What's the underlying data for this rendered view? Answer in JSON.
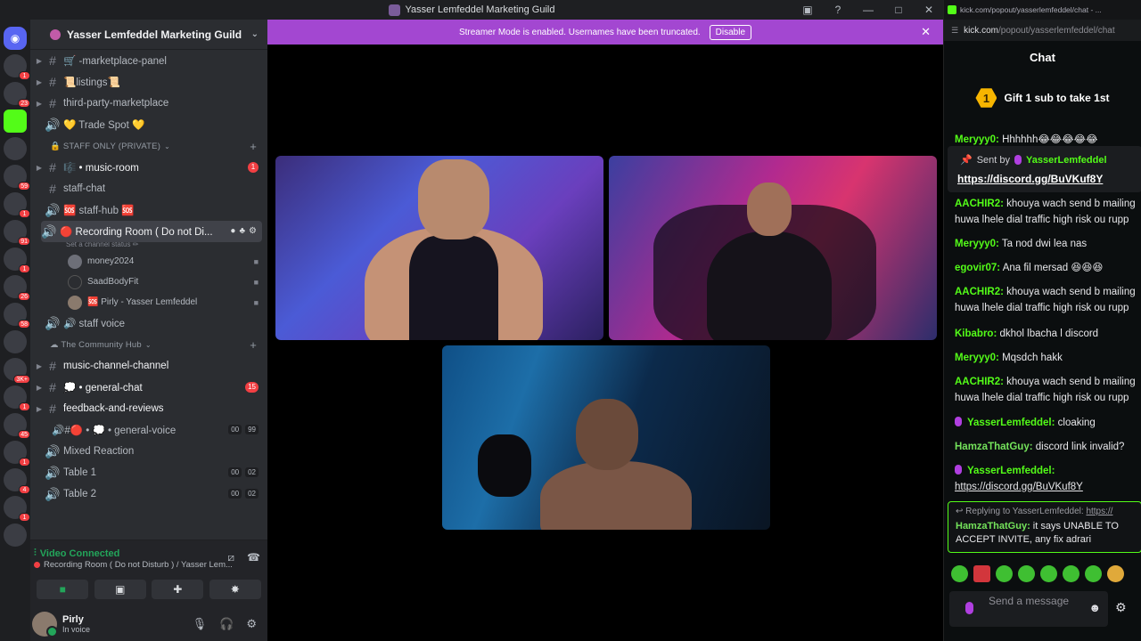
{
  "titlebar": {
    "title": "Yasser Lemfeddel Marketing Guild"
  },
  "rail_badges": [
    "1",
    "23",
    "59",
    "1",
    "91",
    "1",
    "26",
    "58",
    "3K+",
    "1",
    "45",
    "1",
    "4",
    "1"
  ],
  "guild": {
    "name": "Yasser Lemfeddel Marketing Guild"
  },
  "channels": {
    "marketplace_panel": "🛒 -marketplace-panel",
    "listings": "📜listings📜",
    "third_party": "third-party-marketplace",
    "trade_spot": "💛 Trade Spot 💛",
    "staff_category": "🔒 STAFF ONLY (PRIVATE)",
    "music_room": "🎼 • music-room",
    "music_room_badge": "1",
    "staff_chat": "staff-chat",
    "staff_hub": "🆘 staff-hub 🆘",
    "recording_room": "🔴 Recording Room ( Do not Di...",
    "set_status": "Set a channel status ✏",
    "voice_users": [
      "money2024",
      "SaadBodyFit",
      "🆘 Pirly - Yasser Lemfeddel"
    ],
    "staff_voice": "🔊 staff voice",
    "community_category": "☁ The Community Hub",
    "music_channel": "music-channel-channel",
    "general_chat": "💭 • general-chat",
    "general_chat_badge": "15",
    "feedback": "feedback-and-reviews",
    "general_voice": "🔊#🔴 • 💭 • general-voice",
    "general_voice_a": "00",
    "general_voice_b": "99",
    "mixed_reaction": "Mixed Reaction",
    "table1": "Table 1",
    "table1_a": "00",
    "table1_b": "02",
    "table2": "Table 2",
    "table2_a": "00",
    "table2_b": "02"
  },
  "voice": {
    "status": "Video Connected",
    "channel": "Recording Room ( Do not Disturb ) / Yasser Lem..."
  },
  "user": {
    "name": "Pirly",
    "status": "In voice"
  },
  "banner": {
    "text": "Streamer Mode is enabled. Usernames have been truncated.",
    "disable_label": "Disable"
  },
  "chat": {
    "tab_url": "kick.com/popout/yasserlemfeddel/chat - ...",
    "url_host": "kick.com",
    "url_path": "/popout/yasserlemfeddel/chat",
    "title": "Chat",
    "gift_count": "1",
    "gift_text": "Gift 1 sub to take 1st",
    "pinned_sent_by": "Sent by",
    "pinned_user": "YasserLemfeddel",
    "pinned_link": "https://discord.gg/BuVKuf8Y",
    "messages": [
      {
        "user": "Meryyy0:",
        "text": " Hhhhhh😂😂😂😂😂"
      },
      {
        "user": "AACHIR2:",
        "text": " khouya wach send b mailing"
      },
      {
        "user": "",
        "text": "huwa lhele dial traffic high risk ou rupp"
      },
      {
        "user": "Meryyy0:",
        "text": " Ta nod dwi lea nas"
      },
      {
        "user": "egovir07:",
        "text": " Ana fil mersad 😆😆😆"
      },
      {
        "user": "AACHIR2:",
        "text": " khouya wach send b mailing"
      },
      {
        "user": "",
        "text": "huwa lhele dial traffic high risk ou rupp"
      },
      {
        "user": "Kibabro:",
        "text": " dkhol lbacha l discord"
      },
      {
        "user": "Meryyy0:",
        "text": " Mqsdch hakk"
      },
      {
        "user": "AACHIR2:",
        "text": " khouya wach send b mailing"
      },
      {
        "user": "",
        "text": "huwa lhele dial traffic high risk ou rupp"
      },
      {
        "user": "YasserLemfeddel:",
        "text": " cloaking"
      },
      {
        "user": "HamzaThatGuy:",
        "text": " discord link invalid?"
      },
      {
        "user": "YasserLemfeddel:",
        "text": ""
      },
      {
        "user": "",
        "text": "https://discord.gg/BuVKuf8Y"
      }
    ],
    "reply_prefix": "↩ Replying to YasserLemfeddel:",
    "reply_link": "https://",
    "reply_user": "HamzaThatGuy:",
    "reply_text": " it says UNABLE TO ACCEPT INVITE, any fix adrari",
    "input_placeholder": "Send a message"
  }
}
